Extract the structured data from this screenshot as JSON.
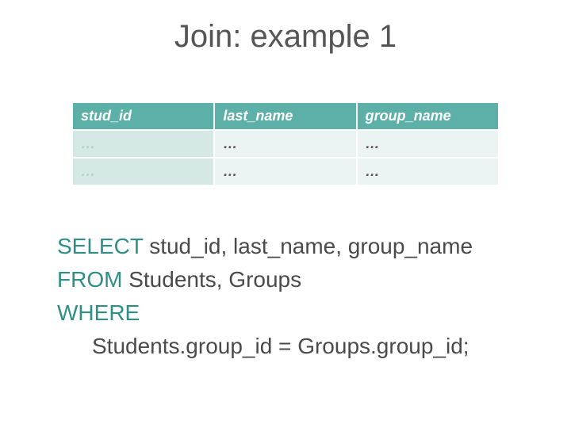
{
  "title": "Join: example 1",
  "table": {
    "headers": [
      "stud_id",
      "last_name",
      "group_name"
    ],
    "rows": [
      [
        "…",
        "…",
        "…"
      ],
      [
        "…",
        "…",
        "…"
      ]
    ]
  },
  "sql": {
    "kw_select": "SELECT",
    "select_cols": " stud_id, last_name, group_name",
    "kw_from": "FROM",
    "from_tables": " Students, Groups",
    "kw_where": "WHERE",
    "where_clause": "Students.group_id = Groups.group_id;"
  }
}
